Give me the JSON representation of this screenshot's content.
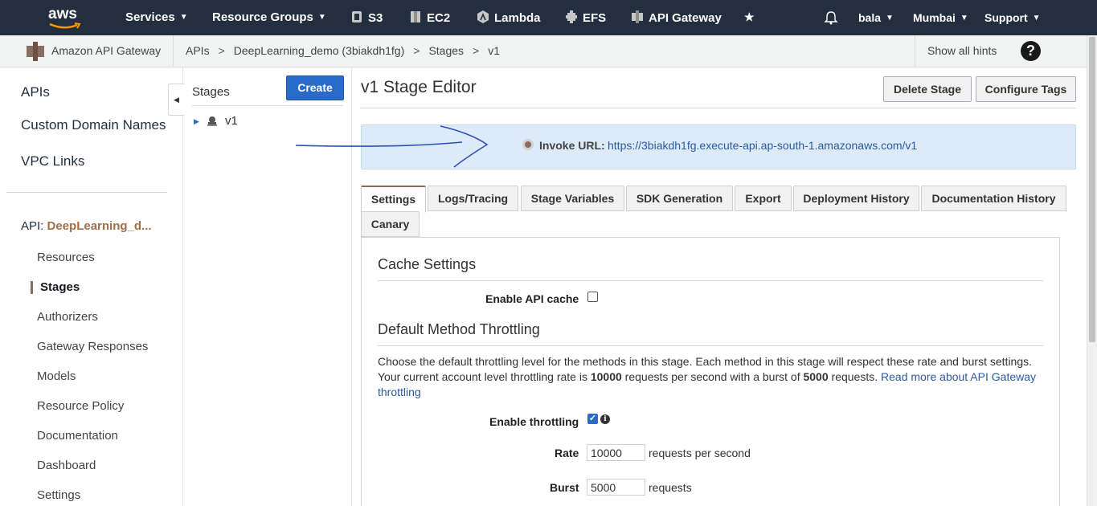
{
  "topbar": {
    "logo": "aws",
    "services": "Services",
    "resource_groups": "Resource Groups",
    "shortcuts": [
      "S3",
      "EC2",
      "Lambda",
      "EFS",
      "API Gateway"
    ],
    "user": "bala",
    "region": "Mumbai",
    "support": "Support"
  },
  "breadcrumb": {
    "service": "Amazon API Gateway",
    "items": [
      "APIs",
      "DeepLearning_demo (3biakdh1fg)",
      "Stages",
      "v1"
    ],
    "hints": "Show all hints",
    "help": "?"
  },
  "sidebar": {
    "links": [
      "APIs",
      "Custom Domain Names",
      "VPC Links"
    ],
    "api_prefix": "API:",
    "api_name": "DeepLearning_d...",
    "sub_items": [
      "Resources",
      "Stages",
      "Authorizers",
      "Gateway Responses",
      "Models",
      "Resource Policy",
      "Documentation",
      "Dashboard",
      "Settings"
    ]
  },
  "stages": {
    "title": "Stages",
    "create": "Create",
    "items": [
      "v1"
    ]
  },
  "main": {
    "title": "v1 Stage Editor",
    "delete_stage": "Delete Stage",
    "configure_tags": "Configure Tags",
    "invoke_label": "Invoke URL:",
    "invoke_url": "https://3biakdh1fg.execute-api.ap-south-1.amazonaws.com/v1",
    "tabs": [
      "Settings",
      "Logs/Tracing",
      "Stage Variables",
      "SDK Generation",
      "Export",
      "Deployment History",
      "Documentation History",
      "Canary"
    ]
  },
  "settings": {
    "cache_title": "Cache Settings",
    "enable_cache_label": "Enable API cache",
    "enable_cache": false,
    "throttle_title": "Default Method Throttling",
    "desc_1": "Choose the default throttling level for the methods in this stage. Each method in this stage will respect these rate and burst settings.",
    "desc_2a": "Your current account level throttling rate is ",
    "desc_rate": "10000",
    "desc_2b": " requests per second with a burst of ",
    "desc_burst": "5000",
    "desc_2c": " requests. ",
    "desc_link": "Read more about API Gateway throttling",
    "enable_throttling_label": "Enable throttling",
    "enable_throttling": true,
    "rate_label": "Rate",
    "rate_value": "10000",
    "rate_unit": "requests per second",
    "burst_label": "Burst",
    "burst_value": "5000",
    "burst_unit": "requests"
  },
  "colors": {
    "topbar": "#232f3e",
    "primary_button": "#2a6ac8",
    "accent": "#8a6d5c",
    "invoke_bg": "#dcebf7",
    "annotation_arrow": "#2f4fb3"
  }
}
